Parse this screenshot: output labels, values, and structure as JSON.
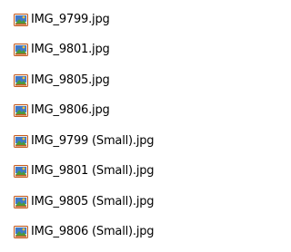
{
  "files": [
    {
      "name": "IMG_9799.jpg",
      "icon": "jpg-image-icon"
    },
    {
      "name": "IMG_9801.jpg",
      "icon": "jpg-image-icon"
    },
    {
      "name": "IMG_9805.jpg",
      "icon": "jpg-image-icon"
    },
    {
      "name": "IMG_9806.jpg",
      "icon": "jpg-image-icon"
    },
    {
      "name": "IMG_9799 (Small).jpg",
      "icon": "jpg-image-icon"
    },
    {
      "name": "IMG_9801 (Small).jpg",
      "icon": "jpg-image-icon"
    },
    {
      "name": "IMG_9805 (Small).jpg",
      "icon": "jpg-image-icon"
    },
    {
      "name": "IMG_9806 (Small).jpg",
      "icon": "jpg-image-icon"
    }
  ],
  "colors": {
    "icon_frame": "#c65b1f",
    "icon_sky": "#3f78c9",
    "icon_land": "#4c9a3c",
    "icon_sun": "#f2c23a"
  }
}
